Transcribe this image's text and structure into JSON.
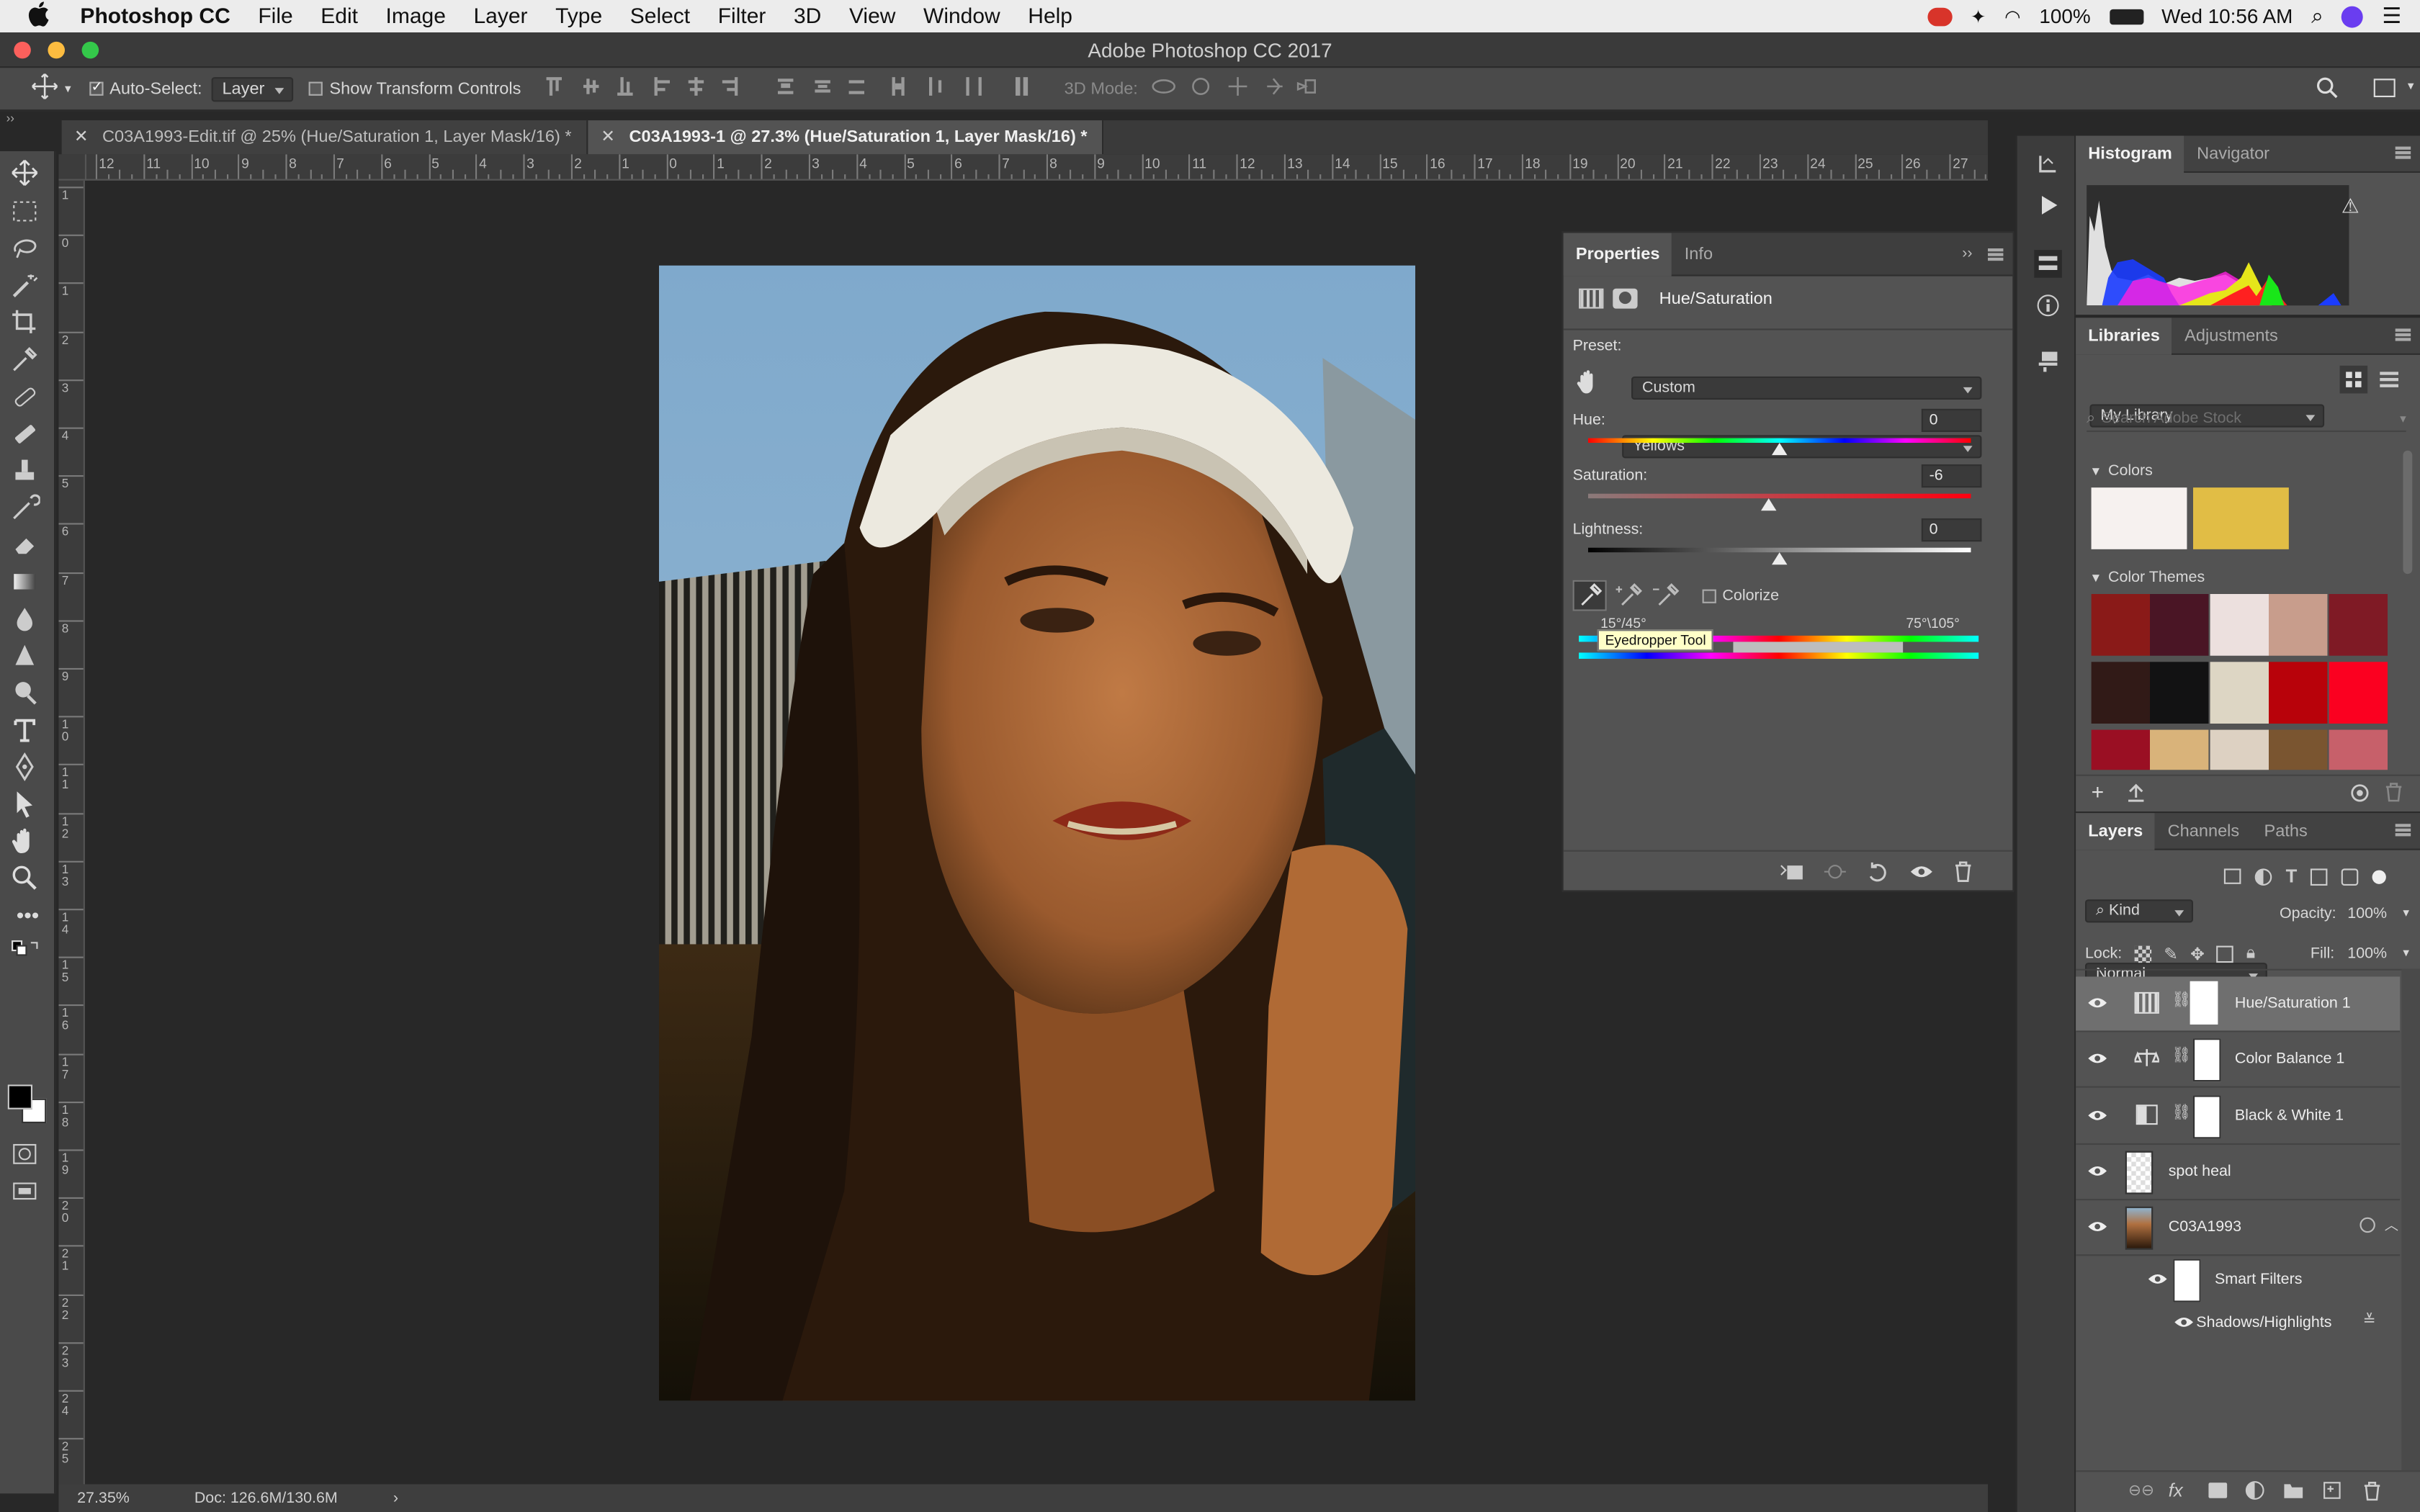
{
  "mac_menu": {
    "app_name": "Photoshop CC",
    "items": [
      "File",
      "Edit",
      "Image",
      "Layer",
      "Type",
      "Select",
      "Filter",
      "3D",
      "View",
      "Window",
      "Help"
    ],
    "battery": "100%",
    "clock": "Wed 10:56 AM"
  },
  "window": {
    "title": "Adobe Photoshop CC 2017"
  },
  "options_bar": {
    "auto_select_label": "Auto-Select:",
    "auto_select_value": "Layer",
    "show_transform_label": "Show Transform Controls",
    "mode_3d_label": "3D Mode:"
  },
  "doc_tabs": [
    {
      "label": "C03A1993-Edit.tif @ 25% (Hue/Saturation 1, Layer Mask/16) *"
    },
    {
      "label": "C03A1993-1 @ 27.3% (Hue/Saturation 1, Layer Mask/16) *"
    }
  ],
  "ruler": {
    "h_ticks": [
      "12",
      "11",
      "10",
      "9",
      "8",
      "7",
      "6",
      "5",
      "4",
      "3",
      "2",
      "1",
      "0",
      "1",
      "2",
      "3",
      "4",
      "5",
      "6",
      "7",
      "8",
      "9",
      "10",
      "11",
      "12",
      "13",
      "14",
      "15",
      "16",
      "17",
      "18",
      "19",
      "20",
      "21",
      "22",
      "23",
      "24",
      "25",
      "26",
      "27"
    ],
    "v_ticks": [
      "1",
      "0",
      "1",
      "2",
      "3",
      "4",
      "5",
      "6",
      "7",
      "8",
      "9",
      "1 0",
      "1 1",
      "1 2",
      "1 3",
      "1 4",
      "1 5",
      "1 6",
      "1 7",
      "1 8",
      "1 9",
      "2 0",
      "2 1",
      "2 2",
      "2 3",
      "2 4",
      "2 5"
    ]
  },
  "status": {
    "zoom": "27.35%",
    "doc": "Doc: 126.6M/130.6M"
  },
  "properties": {
    "tabs": [
      "Properties",
      "Info"
    ],
    "adjustment_name": "Hue/Saturation",
    "preset_label": "Preset:",
    "preset_value": "Custom",
    "channel_value": "Yellows",
    "hue_label": "Hue:",
    "hue_value": "0",
    "saturation_label": "Saturation:",
    "saturation_value": "-6",
    "lightness_label": "Lightness:",
    "lightness_value": "0",
    "colorize_label": "Colorize",
    "range_left": "15°/45°",
    "range_right": "75°\\105°",
    "tooltip": "Eyedropper Tool",
    "hue_level": 0.5,
    "saturation_level": 0.47,
    "lightness_level": 0.5
  },
  "histogram": {
    "tabs": [
      "Histogram",
      "Navigator"
    ]
  },
  "libraries": {
    "tabs": [
      "Libraries",
      "Adjustments"
    ],
    "library_value": "My Library",
    "search_placeholder": "Search Adobe Stock",
    "colors_label": "Colors",
    "colors": [
      "#f6f1ef",
      "#e1bd45"
    ],
    "themes_label": "Color Themes",
    "theme_rows": [
      [
        "#8a1a18",
        "#4a1525",
        "#ece0de",
        "#c89d8c",
        "#7f1a25"
      ],
      [
        "#311a17",
        "#121213",
        "#ddd6c4",
        "#b8020a",
        "#fb0020"
      ],
      [
        "#9a0f23",
        "#d9b37a",
        "#ddd1c2",
        "#7a5530",
        "#c7606a"
      ]
    ]
  },
  "layers": {
    "tabs": [
      "Layers",
      "Channels",
      "Paths"
    ],
    "filter_kind": "Kind",
    "blend_mode": "Normal",
    "opacity_label": "Opacity:",
    "opacity_value": "100%",
    "lock_label": "Lock:",
    "fill_label": "Fill:",
    "fill_value": "100%",
    "items": [
      {
        "name": "Hue/Saturation 1"
      },
      {
        "name": "Color Balance 1"
      },
      {
        "name": "Black & White 1"
      },
      {
        "name": "spot heal"
      },
      {
        "name": "C03A1993"
      }
    ],
    "smart_filters_label": "Smart Filters",
    "shadows_highlights_label": "Shadows/Highlights"
  }
}
